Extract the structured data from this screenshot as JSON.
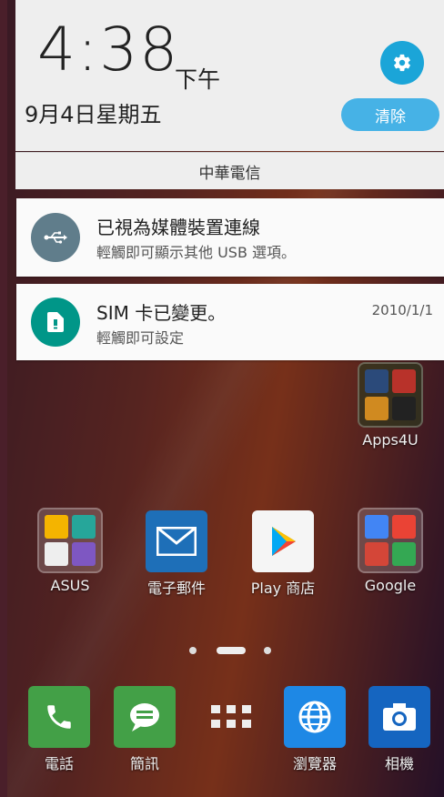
{
  "status": {
    "time": "4:38",
    "ampm": "下午",
    "date": "9月4日星期五",
    "clear_label": "清除",
    "carrier": "中華電信"
  },
  "notifications": [
    {
      "title": "已視為媒體裝置連線",
      "text": "輕觸即可顯示其他 USB 選項。",
      "icon": "usb-icon",
      "color": "#607d8b"
    },
    {
      "title": "SIM 卡已變更。",
      "text": "輕觸即可設定",
      "time": "2010/1/1",
      "icon": "sim-card-icon",
      "color": "#009688"
    }
  ],
  "home": {
    "apps4u": "Apps4U",
    "row": [
      {
        "label": "ASUS"
      },
      {
        "label": "電子郵件"
      },
      {
        "label": "Play 商店"
      },
      {
        "label": "Google"
      }
    ],
    "dock": [
      {
        "label": "電話"
      },
      {
        "label": "簡訊"
      },
      {
        "label": "瀏覽器"
      },
      {
        "label": "相機"
      }
    ]
  }
}
